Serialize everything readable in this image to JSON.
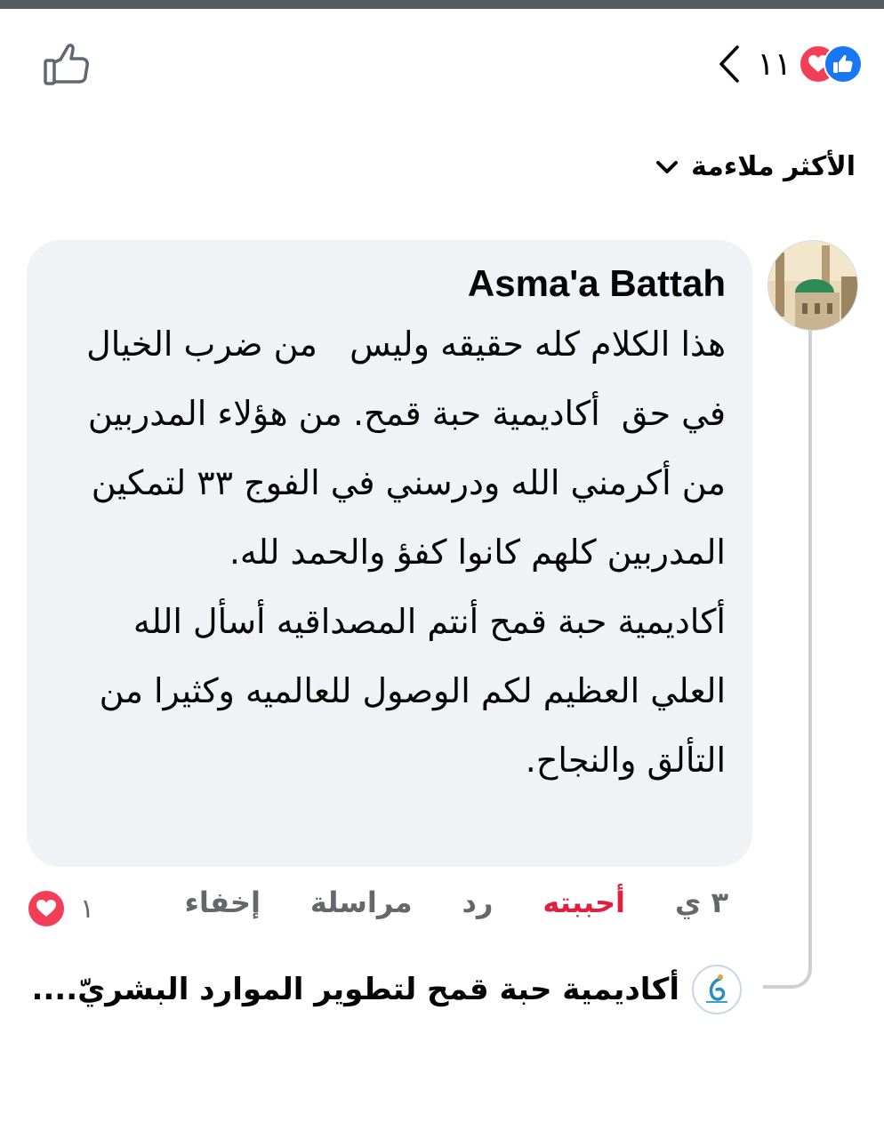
{
  "reactions": {
    "count": "١١",
    "types": [
      "like",
      "love"
    ]
  },
  "sort": {
    "label": "الأكثر ملاءمة"
  },
  "comment": {
    "author": "Asma'a Battah",
    "text": "هذا الكلام كله حقيقه وليس   من ضرب الخيال في حق  أكاديمية حبة قمح. من هؤلاء المدربين من أكرمني الله ودرسني في الفوج ٣٣ لتمكين المدربين كلهم كانوا كفؤ والحمد لله.\nأكاديمية حبة قمح أنتم المصداقيه أسأل الله العلي العظيم لكم الوصول للعالميه وكثيرا من التألق والنجاح.",
    "time": "٣ ي",
    "actions": {
      "like": "أحببته",
      "reply": "رد",
      "message": "مراسلة",
      "hide": "إخفاء"
    },
    "reaction_count": "١"
  },
  "reply_preview": {
    "text": "أكاديمية حبة قمح لتطوير الموارد البشريّ...."
  },
  "colors": {
    "like_blue": "#1877f2",
    "love_red": "#f33e58",
    "liked_text": "#e41e3f",
    "bubble_bg": "#f0f2f5"
  }
}
